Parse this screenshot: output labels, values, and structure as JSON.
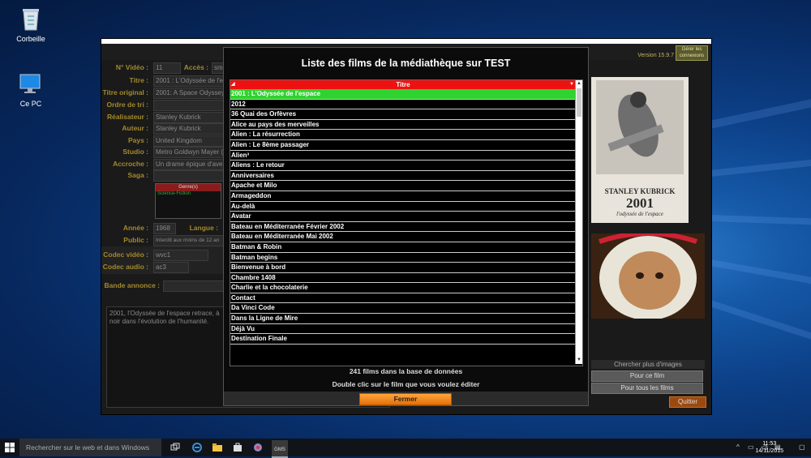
{
  "desktop": {
    "icons": [
      {
        "name": "recycle-bin",
        "label": "Corbeille"
      },
      {
        "name": "this-pc",
        "label": "Ce PC"
      }
    ]
  },
  "app": {
    "version": "Version 15.9.7",
    "connexions_label": "Gérer les connexions",
    "labels": {
      "n_video": "N° Vidéo :",
      "acces": "Accès :",
      "titre": "Titre :",
      "titre_original": "Titre original :",
      "ordre_tri": "Ordre de tri :",
      "realisateur": "Réalisateur :",
      "auteur": "Auteur :",
      "pays": "Pays :",
      "studio": "Studio :",
      "accroche": "Accroche :",
      "saga": "Saga :",
      "annee": "Année :",
      "langue": "Langue :",
      "public": "Public :",
      "codec_video": "Codec vidéo :",
      "codec_audio": "Codec audio :",
      "bande_annonce": "Bande annonce :"
    },
    "values": {
      "n_video": "11",
      "acces": "sm",
      "titre": "2001 : L'Odyssée de l'e",
      "titre_original": "2001: A Space Odyssey",
      "ordre_tri": "",
      "realisateur": "Stanley Kubrick",
      "auteur": "Stanley Kubrick",
      "pays": "United Kingdom",
      "studio": "Metro Goldwyn Mayer (",
      "accroche": "Un drame épique d'ave",
      "saga": "",
      "annee": "1968",
      "public": "Interdit aux moins de 12 an",
      "codec_video": "wvc1",
      "codec_audio": "ac3",
      "bande_annonce": ""
    },
    "genres_header": "Genre(s)",
    "genres": [
      "Science-Fiction"
    ],
    "synopsis": "2001, l'Odyssée de l'espace retrace, à\nnoir dans l'évolution de l'humanité.",
    "poster": {
      "top": "STANLEY KUBRICK",
      "number": "2001",
      "sub": "l'odyssée de l'espace"
    },
    "side": {
      "header": "Chercher plus d'images",
      "btn_this": "Pour ce film",
      "btn_all": "Pour tous les films",
      "quit": "Quitter"
    }
  },
  "modal": {
    "title": "Liste des films de la médiathèque sur TEST",
    "column_header": "Titre",
    "films": [
      "2001 : L'Odyssée de l'espace",
      "2012",
      "36 Quai des Orfèvres",
      "Alice au pays des merveilles",
      "Alien : La résurrection",
      "Alien : Le 8ème passager",
      "Alien³",
      "Aliens : Le retour",
      "Anniversaires",
      "Apache et Milo",
      "Armageddon",
      "Au-delà",
      "Avatar",
      "Bateau en Méditerranée Février 2002",
      "Bateau en Méditerranée Mai 2002",
      "Batman & Robin",
      "Batman begins",
      "Bienvenue à bord",
      "Chambre 1408",
      "Charlie et la chocolaterie",
      "Contact",
      "Da Vinci Code",
      "Dans la Ligne de Mire",
      "Déjà Vu",
      "Destination Finale"
    ],
    "selected_index": 0,
    "count_text": "241 films dans la base de données",
    "hint_text": "Double clic sur le film que vous voulez éditer",
    "close_label": "Fermer"
  },
  "taskbar": {
    "search_placeholder": "Rechercher sur le web et dans Windows",
    "time": "11:53",
    "date": "14/11/2015"
  },
  "colors": {
    "header_red": "#ee1111",
    "selected_green": "#2fd32f",
    "label_gold": "#a38a2c",
    "fermer_orange": "#f08a1e"
  }
}
